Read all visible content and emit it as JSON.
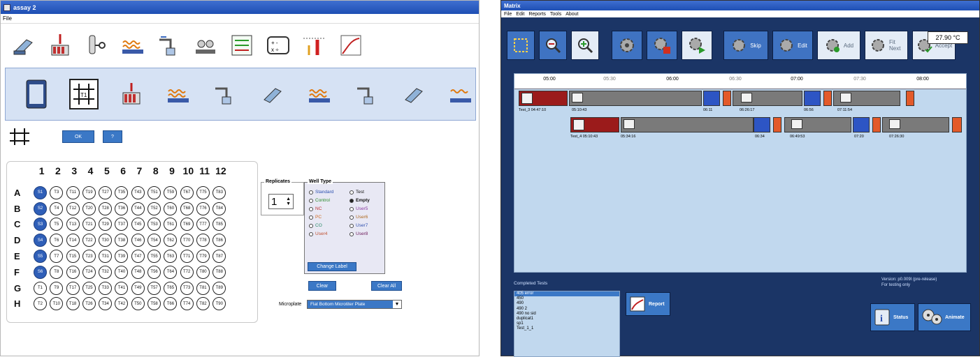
{
  "left": {
    "title": "assay 2",
    "menu": [
      "File"
    ],
    "plate": {
      "cols": [
        "1",
        "2",
        "3",
        "4",
        "5",
        "6",
        "7",
        "8",
        "9",
        "10",
        "11",
        "12"
      ],
      "rows": [
        {
          "label": "A",
          "wells": [
            "S1",
            "T3",
            "T11",
            "T19",
            "T27",
            "T35",
            "T43",
            "T51",
            "T59",
            "T67",
            "T75",
            "T83"
          ]
        },
        {
          "label": "B",
          "wells": [
            "S2",
            "T4",
            "T12",
            "T20",
            "T28",
            "T36",
            "T44",
            "T52",
            "T60",
            "T68",
            "T76",
            "T84"
          ]
        },
        {
          "label": "C",
          "wells": [
            "S3",
            "T5",
            "T13",
            "T21",
            "T29",
            "T37",
            "T45",
            "T53",
            "T61",
            "T69",
            "T77",
            "T85"
          ]
        },
        {
          "label": "D",
          "wells": [
            "S4",
            "T6",
            "T14",
            "T22",
            "T30",
            "T38",
            "T46",
            "T54",
            "T62",
            "T70",
            "T78",
            "T86"
          ]
        },
        {
          "label": "E",
          "wells": [
            "S5",
            "T7",
            "T15",
            "T23",
            "T31",
            "T39",
            "T47",
            "T55",
            "T63",
            "T71",
            "T79",
            "T87"
          ]
        },
        {
          "label": "F",
          "wells": [
            "S6",
            "T8",
            "T16",
            "T24",
            "T32",
            "T40",
            "T48",
            "T56",
            "T64",
            "T72",
            "T80",
            "T88"
          ]
        },
        {
          "label": "G",
          "wells": [
            "T1",
            "T9",
            "T17",
            "T25",
            "T33",
            "T41",
            "T49",
            "T57",
            "T65",
            "T73",
            "T81",
            "T89"
          ]
        },
        {
          "label": "H",
          "wells": [
            "T2",
            "T10",
            "T18",
            "T26",
            "T34",
            "T42",
            "T50",
            "T58",
            "T66",
            "T74",
            "T82",
            "T90"
          ]
        }
      ]
    },
    "ok_label": "OK",
    "help_label": "?",
    "replicates_label": "Replicates",
    "replicates_value": "1",
    "welltype_label": "Well Type",
    "welltypes": [
      {
        "label": "Standard",
        "color": "#2a4fb0",
        "checked": false
      },
      {
        "label": "Test",
        "color": "#111111",
        "checked": false
      },
      {
        "label": "Control",
        "color": "#2a8a2a",
        "checked": false
      },
      {
        "label": "Empty",
        "color": "#111111",
        "checked": true
      },
      {
        "label": "NC",
        "color": "#c03030",
        "checked": false
      },
      {
        "label": "User5",
        "color": "#8a3aa0",
        "checked": false
      },
      {
        "label": "PC",
        "color": "#d06a20",
        "checked": false
      },
      {
        "label": "User6",
        "color": "#b06a20",
        "checked": false
      },
      {
        "label": "CO",
        "color": "#2a8a6a",
        "checked": false
      },
      {
        "label": "User7",
        "color": "#3050b0",
        "checked": false
      },
      {
        "label": "User4",
        "color": "#c05030",
        "checked": false
      },
      {
        "label": "User8",
        "color": "#702060",
        "checked": false
      }
    ],
    "change_label": "Change Label",
    "clear_label": "Clear",
    "clear_all_label": "Clear All",
    "microplate_label": "Microplate",
    "microplate_value": "Flat Bottom Microtiter Plate"
  },
  "right": {
    "title": "Matrix",
    "menu": [
      "File",
      "Edit",
      "Reports",
      "Tools",
      "About"
    ],
    "tools": [
      "Skip",
      "Edit",
      "Add",
      "Fit Next",
      "Accept"
    ],
    "temperature": "27.90 °C",
    "ticks_major": [
      "05:00",
      "06:00",
      "07:00",
      "08:00"
    ],
    "ticks_minor": [
      "05:30",
      "06:30",
      "07:30"
    ],
    "row1": {
      "name_time": "Test_3  04:47:10",
      "t1": "05:10:43",
      "t2": "06:11",
      "t3": "06:26:17",
      "t4": "06:56",
      "t5": "07:11:54"
    },
    "row2": {
      "name_time": "Test_4  05:10:43",
      "t1": "05:34:16",
      "t2": "06:34",
      "t3": "06:49:53",
      "t4": "07:20",
      "t5": "07:26:30"
    },
    "completed_title": "Completed Tests",
    "completed": [
      "405 error",
      "450",
      "490",
      "490 2",
      "490 no sid",
      "duplicat1",
      "sp1",
      "Test_1_1"
    ],
    "report_label": "Report",
    "version_line1": "Version: p0.009I (pre-release)",
    "version_line2": "For testing only",
    "status_label": "Status",
    "animate_label": "Animate"
  }
}
